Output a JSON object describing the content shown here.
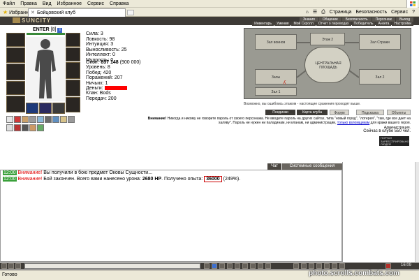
{
  "browser": {
    "menu": [
      "Файл",
      "Правка",
      "Вид",
      "Избранное",
      "Сервис",
      "Справка"
    ],
    "favorites_label": "Избранное",
    "tab_title": "Бойцовский клуб",
    "tools": [
      "Страница",
      "Безопасность",
      "Сервис"
    ],
    "status_text": "Готово"
  },
  "game_header": {
    "logo": "SUNCITY",
    "top_links": [
      "Знания",
      "Общение",
      "Безопасность",
      "Персонаж",
      "Выход"
    ],
    "sub_links": [
      "Инвентарь",
      "Умения",
      "Мой Скролл",
      "Отчет о переводах",
      "Победитель",
      "Анкета",
      "Настройки"
    ]
  },
  "character": {
    "name": "ENTER",
    "level": "[8]",
    "stats": [
      "Сила: 3",
      "Ловкость: 98",
      "Интуиция: 3",
      "Выносливость: 25",
      "Интеллект: 0",
      "Мудрость: 0"
    ],
    "experience_label": "Опыт:",
    "experience_value": "857 148",
    "experience_next": "(900 000)",
    "records": [
      "Уровень: 8",
      "Побед: 420",
      "Поражений: 207",
      "Ничьих: 1"
    ],
    "money_label": "Деньги:",
    "clan": "Клан: Bods",
    "transfers": "Передач: 200"
  },
  "map": {
    "rooms": [
      "Зал воинов",
      "Этаж 2",
      "Зал Стражи",
      "Залы",
      "Зал 1",
      "Зал 2"
    ],
    "center": "ЦЕНТРАЛЬНАЯ ПЛОЩАДЬ",
    "note": "Возможно, вы ошиблись этажом - настоящие сражения проходят выше."
  },
  "nav_buttons": [
    "Поединки",
    "Карта клуба",
    "Форум",
    "Подсказка",
    "Объекты"
  ],
  "warning": {
    "title": "Внимание!",
    "text": "Никогда и никому не говорите пароль от своего персонажа. Не вводите пароль на других сайтах, типа \"новый город\", \"лотерея\", \"там, где все дает на халяву\". Пароль не нужен ни паладинам, ни кланам, ни администрации,",
    "link": "только взломщикам",
    "tail": "для кражи вашего героя.",
    "signature": "Администрация.",
    "online": "Сейчас в клубе 550 чел."
  },
  "counter": [
    "ПОРТАЛ",
    "ЗАРЕЕСТРИРОВАНО",
    "ЛЮДЕЙ"
  ],
  "chat": {
    "tabs": [
      "Чат",
      "Системные сообщения"
    ],
    "messages": [
      {
        "time": "12:00",
        "prefix": "Внимание!",
        "text": "Вы получили в бою предмет Оковы Сущности..."
      },
      {
        "time": "12:00",
        "prefix": "Внимание!",
        "text_a": "Бой закончен. Всего вами нанесено урона:",
        "damage": "2680 HP",
        "text_b": ". Получено опыта:",
        "exp": "36000",
        "text_c": "(249%)."
      }
    ]
  },
  "game_bar": {
    "time": "16:09"
  },
  "watermark": "photo.scrolls.combats.com"
}
